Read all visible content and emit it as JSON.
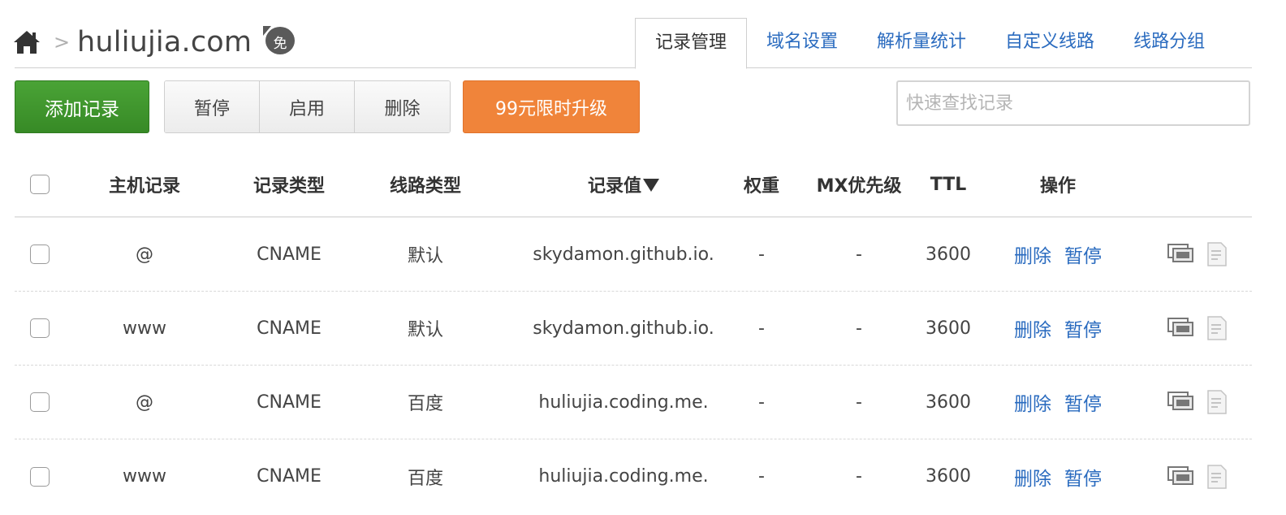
{
  "header": {
    "home_icon": "home-icon",
    "separator": ">",
    "domain": "huliujia.com",
    "badge": "免"
  },
  "tabs": [
    {
      "label": "记录管理",
      "active": true
    },
    {
      "label": "域名设置",
      "active": false
    },
    {
      "label": "解析量统计",
      "active": false
    },
    {
      "label": "自定义线路",
      "active": false
    },
    {
      "label": "线路分组",
      "active": false
    }
  ],
  "toolbar": {
    "add_label": "添加记录",
    "pause_label": "暂停",
    "enable_label": "启用",
    "delete_label": "删除",
    "upgrade_label": "99元限时升级",
    "search_placeholder": "快速查找记录",
    "search_value": ""
  },
  "table": {
    "headers": {
      "host": "主机记录",
      "type": "记录类型",
      "line": "线路类型",
      "value": "记录值",
      "weight": "权重",
      "mx": "MX优先级",
      "ttl": "TTL",
      "ops": "操作"
    },
    "rows": [
      {
        "host": "@",
        "type": "CNAME",
        "line": "默认",
        "value": "skydamon.github.io.",
        "weight": "-",
        "mx": "-",
        "ttl": "3600",
        "delete": "删除",
        "pause": "暂停"
      },
      {
        "host": "www",
        "type": "CNAME",
        "line": "默认",
        "value": "skydamon.github.io.",
        "weight": "-",
        "mx": "-",
        "ttl": "3600",
        "delete": "删除",
        "pause": "暂停"
      },
      {
        "host": "@",
        "type": "CNAME",
        "line": "百度",
        "value": "huliujia.coding.me.",
        "weight": "-",
        "mx": "-",
        "ttl": "3600",
        "delete": "删除",
        "pause": "暂停"
      },
      {
        "host": "www",
        "type": "CNAME",
        "line": "百度",
        "value": "huliujia.coding.me.",
        "weight": "-",
        "mx": "-",
        "ttl": "3600",
        "delete": "删除",
        "pause": "暂停"
      }
    ]
  },
  "colors": {
    "link": "#2a6bbf",
    "add_button": "#3f9a2f",
    "upgrade_button": "#f0843a"
  }
}
